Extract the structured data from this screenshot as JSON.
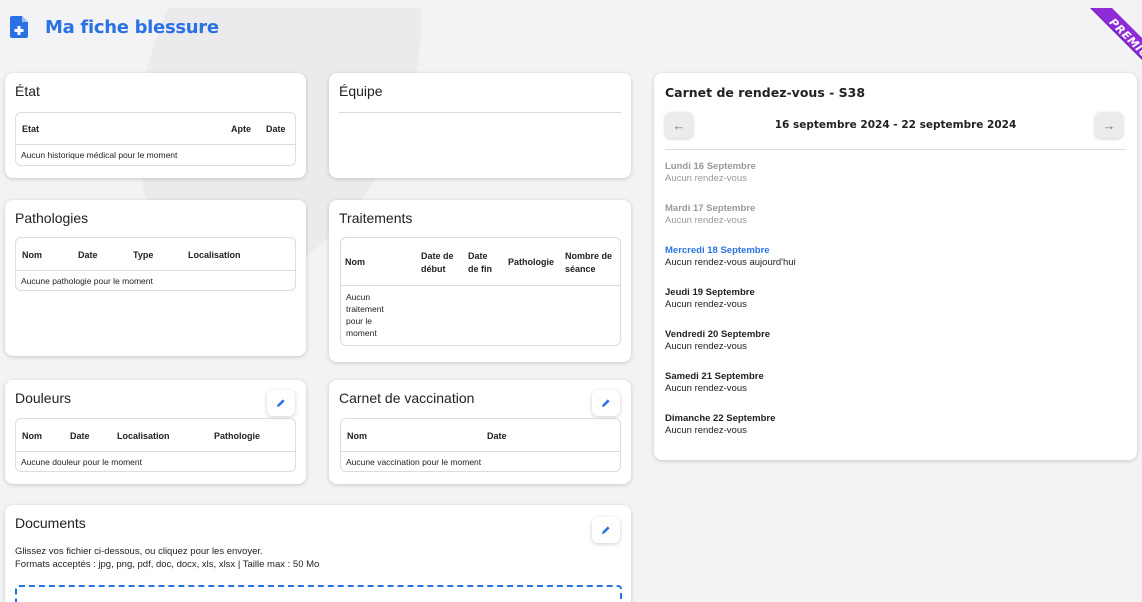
{
  "header": {
    "title": "Ma fiche blessure"
  },
  "premium_badge": "PREMIUM",
  "etat": {
    "title": "État",
    "columns": [
      "Etat",
      "Apte",
      "Date"
    ],
    "empty": "Aucun historique médical pour le moment"
  },
  "equipe": {
    "title": "Équipe"
  },
  "pathologies": {
    "title": "Pathologies",
    "columns": [
      "Nom",
      "Date",
      "Type",
      "Localisation"
    ],
    "empty": "Aucune pathologie pour le moment"
  },
  "traitements": {
    "title": "Traitements",
    "columns": [
      "Nom",
      "Date de début",
      "Date de fin",
      "Pathologie",
      "Nombre de séance"
    ],
    "empty": "Aucun traitement pour le moment"
  },
  "douleurs": {
    "title": "Douleurs",
    "columns": [
      "Nom",
      "Date",
      "Localisation",
      "Pathologie"
    ],
    "empty": "Aucune douleur pour le moment"
  },
  "vaccination": {
    "title": "Carnet de vaccination",
    "columns": [
      "Nom",
      "Date"
    ],
    "empty": "Aucune vaccination pour le moment"
  },
  "documents": {
    "title": "Documents",
    "instructions": "Glissez vos fichier ci-dessous, ou cliquez pour les envoyer.",
    "formats": "Formats acceptés : jpg, png, pdf, doc, docx, xls, xlsx | Taille max : 50 Mo"
  },
  "calendar": {
    "title": "Carnet de rendez-vous - S38",
    "range_start": "16 septembre 2024",
    "range_sep": " - ",
    "range_end": "22 septembre 2024",
    "days": [
      {
        "name": "Lundi 16 Septembre",
        "note": "Aucun rendez-vous",
        "state": "past"
      },
      {
        "name": "Mardi 17 Septembre",
        "note": "Aucun rendez-vous",
        "state": "past"
      },
      {
        "name": "Mercredi 18 Septembre",
        "note": "Aucun rendez-vous aujourd'hui",
        "state": "today"
      },
      {
        "name": "Jeudi 19 Septembre",
        "note": "Aucun rendez-vous",
        "state": "future"
      },
      {
        "name": "Vendredi 20 Septembre",
        "note": "Aucun rendez-vous",
        "state": "future"
      },
      {
        "name": "Samedi 21 Septembre",
        "note": "Aucun rendez-vous",
        "state": "future"
      },
      {
        "name": "Dimanche 22 Septembre",
        "note": "Aucun rendez-vous",
        "state": "future"
      }
    ]
  },
  "colors": {
    "accent": "#2a72e3",
    "premium": "#8e2bd9",
    "past_text": "#999999"
  },
  "icons": {
    "header": "medical-file-icon",
    "edit": "pencil-icon",
    "prev": "arrow-left-icon",
    "next": "arrow-right-icon"
  }
}
